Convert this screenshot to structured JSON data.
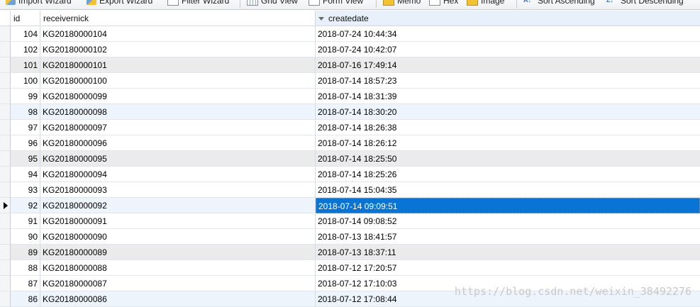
{
  "toolbar": {
    "items": [
      {
        "label": "Import Wizard",
        "icon": "import-icon"
      },
      {
        "label": "Export Wizard",
        "icon": "export-icon"
      },
      {
        "label": "Filter Wizard",
        "icon": "filter-icon"
      },
      {
        "label": "Grid View",
        "icon": "grid-view-icon"
      },
      {
        "label": "Form View",
        "icon": "form-view-icon"
      },
      {
        "label": "Memo",
        "icon": "memo-icon"
      },
      {
        "label": "Hex",
        "icon": "hex-icon"
      },
      {
        "label": "Image",
        "icon": "image-icon"
      },
      {
        "label": "Sort Ascending",
        "icon": "sort-ascending-icon"
      },
      {
        "label": "Sort Descending",
        "icon": "sort-descending-icon"
      }
    ]
  },
  "grid": {
    "columns": [
      "id",
      "receivernick",
      "createdate"
    ],
    "sorted_column": "createdate",
    "sort_direction": "descending",
    "selection_color": "#0a74d5",
    "rows": [
      {
        "id": "104",
        "receivernick": "KG20180000104",
        "createdate": "2018-07-24 10:44:34"
      },
      {
        "id": "102",
        "receivernick": "KG20180000102",
        "createdate": "2018-07-24 10:42:07"
      },
      {
        "id": "101",
        "receivernick": "KG20180000101",
        "createdate": "2018-07-16 17:49:14"
      },
      {
        "id": "100",
        "receivernick": "KG20180000100",
        "createdate": "2018-07-14 18:57:23"
      },
      {
        "id": "99",
        "receivernick": "KG20180000099",
        "createdate": "2018-07-14 18:31:39"
      },
      {
        "id": "98",
        "receivernick": "KG20180000098",
        "createdate": "2018-07-14 18:30:20"
      },
      {
        "id": "97",
        "receivernick": "KG20180000097",
        "createdate": "2018-07-14 18:26:38"
      },
      {
        "id": "96",
        "receivernick": "KG20180000096",
        "createdate": "2018-07-14 18:26:12"
      },
      {
        "id": "95",
        "receivernick": "KG20180000095",
        "createdate": "2018-07-14 18:25:50"
      },
      {
        "id": "94",
        "receivernick": "KG20180000094",
        "createdate": "2018-07-14 18:25:26"
      },
      {
        "id": "93",
        "receivernick": "KG20180000093",
        "createdate": "2018-07-14 15:04:35"
      },
      {
        "id": "92",
        "receivernick": "KG20180000092",
        "createdate": "2018-07-14 09:09:51"
      },
      {
        "id": "91",
        "receivernick": "KG20180000091",
        "createdate": "2018-07-14 09:08:52"
      },
      {
        "id": "90",
        "receivernick": "KG20180000090",
        "createdate": "2018-07-13 18:41:57"
      },
      {
        "id": "89",
        "receivernick": "KG20180000089",
        "createdate": "2018-07-13 18:37:11"
      },
      {
        "id": "88",
        "receivernick": "KG20180000088",
        "createdate": "2018-07-12 17:20:57"
      },
      {
        "id": "87",
        "receivernick": "KG20180000087",
        "createdate": "2018-07-12 17:10:03"
      },
      {
        "id": "86",
        "receivernick": "KG20180000086",
        "createdate": "2018-07-12 17:08:44"
      }
    ]
  },
  "watermark": "https://blog.csdn.net/weixin_38492276"
}
